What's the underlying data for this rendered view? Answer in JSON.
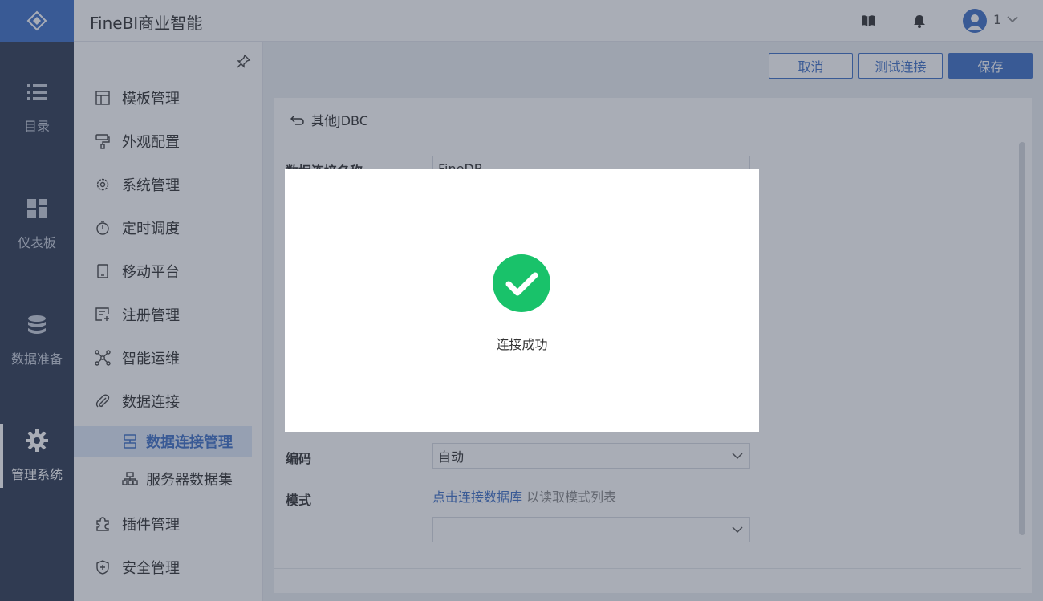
{
  "app": {
    "title": "FineBI商业智能"
  },
  "rail": {
    "items": [
      {
        "label": "目录",
        "icon": "list-icon"
      },
      {
        "label": "仪表板",
        "icon": "dashboard-icon"
      },
      {
        "label": "数据准备",
        "icon": "database-icon"
      },
      {
        "label": "管理系统",
        "icon": "gear-icon",
        "active": true
      }
    ]
  },
  "topbar": {
    "user": "1"
  },
  "nav": {
    "items": [
      {
        "label": "模板管理",
        "icon": "template-icon"
      },
      {
        "label": "外观配置",
        "icon": "paint-roller-icon"
      },
      {
        "label": "系统管理",
        "icon": "gear-icon"
      },
      {
        "label": "定时调度",
        "icon": "stopwatch-icon"
      },
      {
        "label": "移动平台",
        "icon": "tablet-icon"
      },
      {
        "label": "注册管理",
        "icon": "register-icon"
      },
      {
        "label": "智能运维",
        "icon": "network-icon"
      },
      {
        "label": "数据连接",
        "icon": "paperclip-icon"
      }
    ],
    "subitems": [
      {
        "label": "数据连接管理",
        "icon": "connection-icon",
        "active": true
      },
      {
        "label": "服务器数据集",
        "icon": "server-dataset-icon"
      }
    ],
    "items_after": [
      {
        "label": "插件管理",
        "icon": "puzzle-icon"
      },
      {
        "label": "安全管理",
        "icon": "shield-icon"
      }
    ]
  },
  "actions": {
    "cancel": "取消",
    "test": "测试连接",
    "save": "保存"
  },
  "panel": {
    "back_label": "其他JDBC",
    "fields": {
      "name_label": "数据连接名称",
      "name_value": "FineDB",
      "encoding_label": "编码",
      "encoding_value": "自动",
      "schema_label": "模式",
      "schema_link": "点击连接数据库",
      "schema_hint": "以读取模式列表",
      "schema_value": ""
    }
  },
  "modal": {
    "message": "连接成功",
    "status_color": "#19c26a"
  },
  "colors": {
    "primary": "#3f70c7",
    "rail": "#2f3b54",
    "success": "#19c26a"
  }
}
